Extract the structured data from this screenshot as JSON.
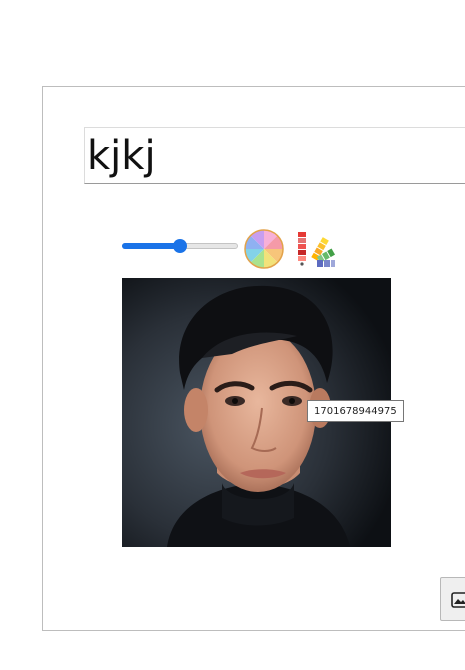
{
  "title_field": {
    "value": "kjkj"
  },
  "toolbar": {
    "size_slider": {
      "value": 0.5
    },
    "color_wheel_icon": "color-wheel-icon",
    "palette_icon": "color-palette-icon"
  },
  "photo": {
    "tooltip": "1701678944975"
  },
  "image_button": {
    "icon": "image-icon"
  },
  "colors": {
    "accent": "#1a73e8",
    "border": "#bdbdbd"
  }
}
